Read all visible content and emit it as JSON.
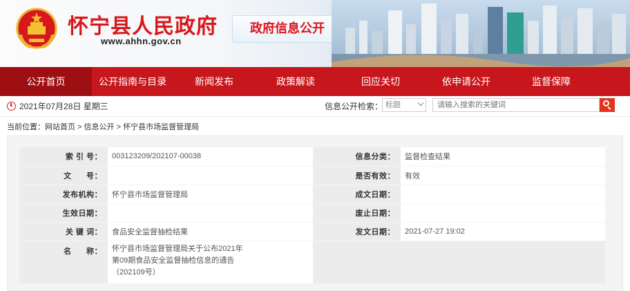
{
  "header": {
    "site_title": "怀宁县人民政府",
    "site_url": "www.ahhn.gov.cn",
    "portal_badge": "政府信息公开",
    "emblem_icon": "national-emblem-icon",
    "colors": {
      "brand_red": "#d8171c",
      "nav_red": "#c8161d",
      "nav_active": "#9e0f14"
    }
  },
  "nav": {
    "items": [
      {
        "label": "公开首页"
      },
      {
        "label": "公开指南与目录"
      },
      {
        "label": "新闻发布"
      },
      {
        "label": "政策解读"
      },
      {
        "label": "回应关切"
      },
      {
        "label": "依申请公开"
      },
      {
        "label": "监督保障"
      }
    ],
    "active_index": 0
  },
  "infobar": {
    "date": "2021年07月28日 星期三",
    "search_label": "信息公开检索：",
    "select_value": "标题",
    "search_placeholder": "请输入搜索的关键词"
  },
  "breadcrumb": "当前位置：网站首页 > 信息公开 > 怀宁县市场监督管理局",
  "meta": {
    "index_label": "索 引 号：",
    "index_value": "003123209/202107-00038",
    "category_label": "信息分类：",
    "category_value": "监督检查结果",
    "docno_label": "文      号：",
    "docno_value": "",
    "valid_label": "是否有效：",
    "valid_value": "有效",
    "org_label": "发布机构：",
    "org_value": "怀宁县市场监督管理局",
    "created_label": "成文日期：",
    "created_value": "",
    "effective_label": "生效日期：",
    "effective_value": "",
    "expire_label": "废止日期：",
    "expire_value": "",
    "keywords_label": "关 键 词：",
    "keywords_value": "食品安全监督抽检结果",
    "published_label": "发文日期：",
    "published_value": "2021-07-27 19:02",
    "name_label": "名      称：",
    "name_line1": "怀宁县市场监督管理局关于公布2021年",
    "name_line2": "第09期食品安全监督抽检信息的通告",
    "name_line3": "（202109号）"
  }
}
